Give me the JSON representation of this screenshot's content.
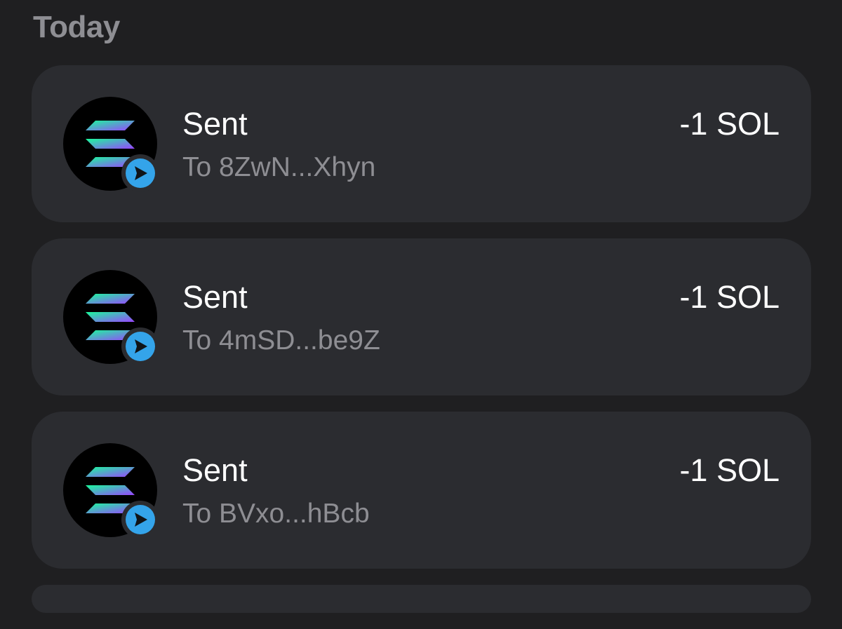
{
  "section": {
    "title": "Today"
  },
  "transactions": [
    {
      "title": "Sent",
      "subtitle": "To 8ZwN...Xhyn",
      "amount": "-1 SOL",
      "token_icon": "solana-icon",
      "badge_icon": "send-icon"
    },
    {
      "title": "Sent",
      "subtitle": "To 4mSD...be9Z",
      "amount": "-1 SOL",
      "token_icon": "solana-icon",
      "badge_icon": "send-icon"
    },
    {
      "title": "Sent",
      "subtitle": "To BVxo...hBcb",
      "amount": "-1 SOL",
      "token_icon": "solana-icon",
      "badge_icon": "send-icon"
    }
  ],
  "colors": {
    "background": "#1f1f21",
    "card": "#2b2c30",
    "primary_text": "#ffffff",
    "secondary_text": "#8e8e93",
    "badge": "#34a4ea",
    "solana_gradient_start": "#19fb9b",
    "solana_gradient_end": "#9945ff"
  }
}
